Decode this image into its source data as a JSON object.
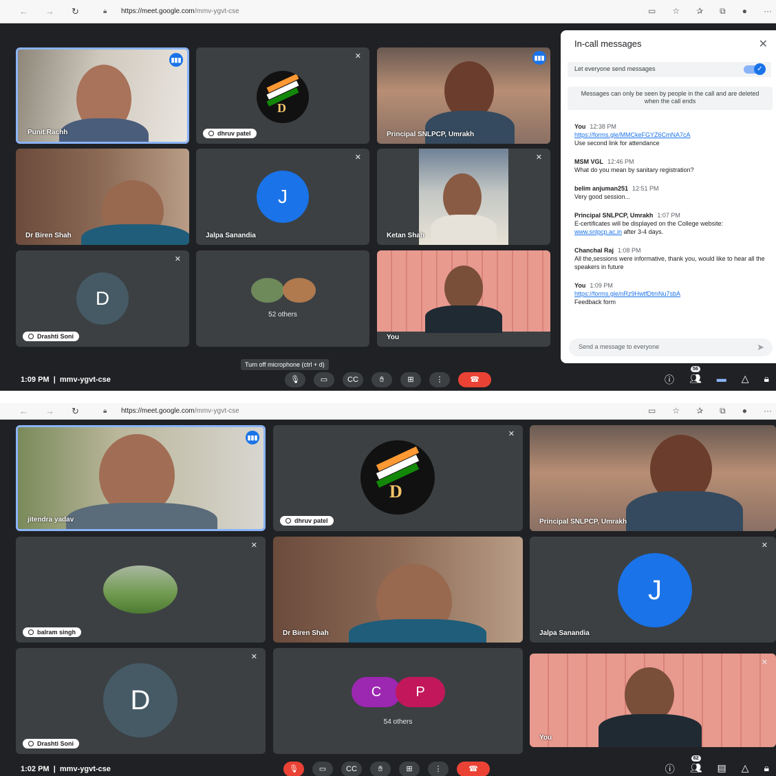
{
  "shot1": {
    "url_host": "https://meet.google.com",
    "url_path": "/mmv-ygvt-cse",
    "time": "1:09 PM",
    "meeting_code": "mmv-ygvt-cse",
    "tooltip": "Turn off microphone (ctrl + d)",
    "participants_badge": "56",
    "tiles": {
      "punit": "Punit Rachh",
      "dhruv": "dhruv patel",
      "principal": "Principal SNLPCP, Umrakh",
      "biren": "Dr Biren Shah",
      "jalpa": "Jalpa Sanandia",
      "jalpa_initial": "J",
      "ketan": "Ketan Shah",
      "drashti": "Drashti Soni",
      "drashti_initial": "D",
      "others": "52 others",
      "you": "You"
    },
    "chat": {
      "title": "In-call messages",
      "toggle_label": "Let everyone send messages",
      "note": "Messages can only be seen by people in the call and are deleted when the call ends",
      "messages": [
        {
          "who": "You",
          "time": "12:38 PM",
          "link": "https://forms.gle/MMCkeFGYZ6CmNA7cA",
          "text": "Use second link for attendance"
        },
        {
          "who": "MSM VGL",
          "time": "12:46 PM",
          "text": "What do you mean by sanitary registration?"
        },
        {
          "who": "belim anjuman251",
          "time": "12:51 PM",
          "text": "Very good session..."
        },
        {
          "who": "Principal SNLPCP, Umrakh",
          "time": "1:07 PM",
          "text": "E-certificates will be displayed on the College website:",
          "link": "www.snlpcp.ac.in",
          "text_after": "after 3-4 days."
        },
        {
          "who": "Chanchal Raj",
          "time": "1:08 PM",
          "text": "All the,sessions were informative, thank you,  would like to hear all the speakers in future"
        },
        {
          "who": "You",
          "time": "1:09 PM",
          "link": "https://forms.gle/nRz9HwtfDtmNu7sbA",
          "text": "Feedback form"
        }
      ],
      "send_placeholder": "Send a message to everyone"
    }
  },
  "shot2": {
    "url_host": "https://meet.google.com",
    "url_path": "/mmv-ygvt-cse",
    "time": "1:02 PM",
    "meeting_code": "mmv-ygvt-cse",
    "participants_badge": "62",
    "tiles": {
      "jitendra": "jitendra yadav",
      "dhruv": "dhruv patel",
      "principal": "Principal SNLPCP, Umrakh",
      "balram": "balram singh",
      "biren": "Dr Biren Shah",
      "jalpa": "Jalpa Sanandia",
      "jalpa_initial": "J",
      "drashti": "Drashti Soni",
      "drashti_initial": "D",
      "c_initial": "C",
      "p_initial": "P",
      "others": "54 others",
      "you": "You"
    }
  },
  "colors": {
    "meet_bg": "#202124",
    "tile_bg": "#3c4043",
    "accent_blue": "#1a73e8",
    "end_call_red": "#ea4335",
    "jalpa_avatar": "#1a73e8",
    "drashti_avatar": "#455a64",
    "c_avatar": "#9c27b0",
    "p_avatar": "#c2185b"
  }
}
